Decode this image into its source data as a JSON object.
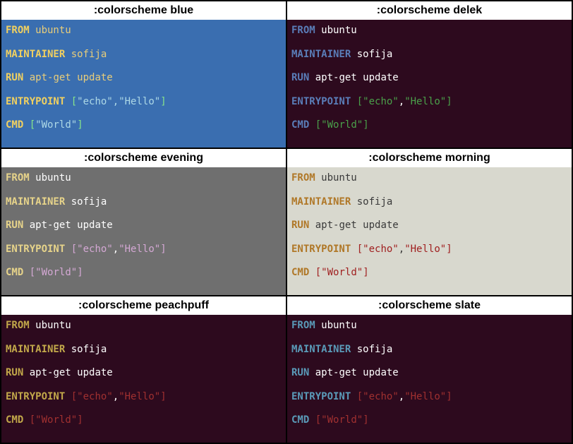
{
  "schemes": [
    {
      "title": ":colorscheme blue",
      "bg": "bg-blue",
      "colors": {
        "keyword": "#f0d060",
        "identifier": "#e8cd7a",
        "text": "#add8e6",
        "bracket": "#87e58a",
        "string": "#add8e6"
      }
    },
    {
      "title": ":colorscheme delek",
      "bg": "bg-delek",
      "colors": {
        "keyword": "#5a7db8",
        "identifier": "#ffffff",
        "text": "#ffffff",
        "bracket": "#4aa04a",
        "string": "#4aa04a"
      }
    },
    {
      "title": ":colorscheme evening",
      "bg": "bg-evening",
      "colors": {
        "keyword": "#e6d38a",
        "identifier": "#ffffff",
        "text": "#ffffff",
        "bracket": "#d4a8d4",
        "string": "#d4a8d4"
      }
    },
    {
      "title": ":colorscheme morning",
      "bg": "bg-morning",
      "colors": {
        "keyword": "#b07828",
        "identifier": "#3a3a3a",
        "text": "#3a3a3a",
        "bracket": "#a02020",
        "string": "#a02020"
      }
    },
    {
      "title": ":colorscheme peachpuff",
      "bg": "bg-peachpuff",
      "colors": {
        "keyword": "#c2a84a",
        "identifier": "#ffffff",
        "text": "#ffffff",
        "bracket": "#a03030",
        "string": "#a03030"
      }
    },
    {
      "title": ":colorscheme slate",
      "bg": "bg-slate",
      "colors": {
        "keyword": "#5a9ab8",
        "identifier": "#ffffff",
        "text": "#ffffff",
        "bracket": "#a03030",
        "string": "#a03030"
      }
    }
  ],
  "dockerfile": {
    "lines": [
      {
        "keyword": "FROM",
        "rest": [
          {
            "t": "identifier",
            "v": " ubuntu"
          }
        ]
      },
      {
        "blank": true
      },
      {
        "keyword": "MAINTAINER",
        "rest": [
          {
            "t": "identifier",
            "v": " sofija"
          }
        ]
      },
      {
        "blank": true
      },
      {
        "keyword": "RUN",
        "rest": [
          {
            "t": "identifier",
            "v": " apt-get update"
          }
        ]
      },
      {
        "blank": true
      },
      {
        "keyword": "ENTRYPOINT",
        "rest": [
          {
            "t": "text",
            "v": " "
          },
          {
            "t": "bracket",
            "v": "["
          },
          {
            "t": "string",
            "v": "\"echo\""
          },
          {
            "t": "text",
            "v": ","
          },
          {
            "t": "string",
            "v": "\"Hello\""
          },
          {
            "t": "bracket",
            "v": "]"
          }
        ]
      },
      {
        "blank": true
      },
      {
        "keyword": "CMD",
        "rest": [
          {
            "t": "text",
            "v": " "
          },
          {
            "t": "bracket",
            "v": "["
          },
          {
            "t": "string",
            "v": "\"World\""
          },
          {
            "t": "bracket",
            "v": "]"
          }
        ]
      }
    ]
  }
}
